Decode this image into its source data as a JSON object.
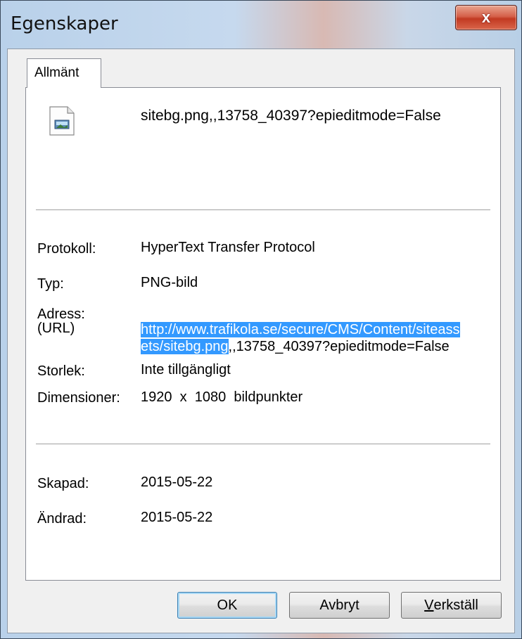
{
  "window": {
    "title": "Egenskaper",
    "close_glyph": "x"
  },
  "tabs": [
    {
      "label": "Allmänt"
    }
  ],
  "file": {
    "icon": "image-file-icon",
    "name": "sitebg.png,,13758_40397?epieditmode=False"
  },
  "details": {
    "protocol_label": "Protokoll:",
    "protocol_value": "HyperText Transfer Protocol",
    "type_label": "Typ:",
    "type_value": "PNG-bild",
    "address_label_1": "Adress:",
    "address_label_2": "(URL)",
    "url_selected_1": "http://www.trafikola.se/secure/CMS/Content/siteass",
    "url_selected_2": "ets/sitebg.png",
    "url_rest": ",,13758_40397?epieditmode=False",
    "size_label": "Storlek:",
    "size_value": "Inte tillgängligt",
    "dimensions_label": "Dimensioner:",
    "dimensions_value": "1920  x  1080  bildpunkter"
  },
  "dates": {
    "created_label": "Skapad:",
    "created_value": "2015-05-22",
    "modified_label": "Ändrad:",
    "modified_value": "2015-05-22"
  },
  "buttons": {
    "ok": "OK",
    "cancel": "Avbryt",
    "apply_mnemonic": "V",
    "apply_rest": "erkställ"
  },
  "colors": {
    "selection": "#3399ff",
    "close_button": "#c8452c"
  }
}
